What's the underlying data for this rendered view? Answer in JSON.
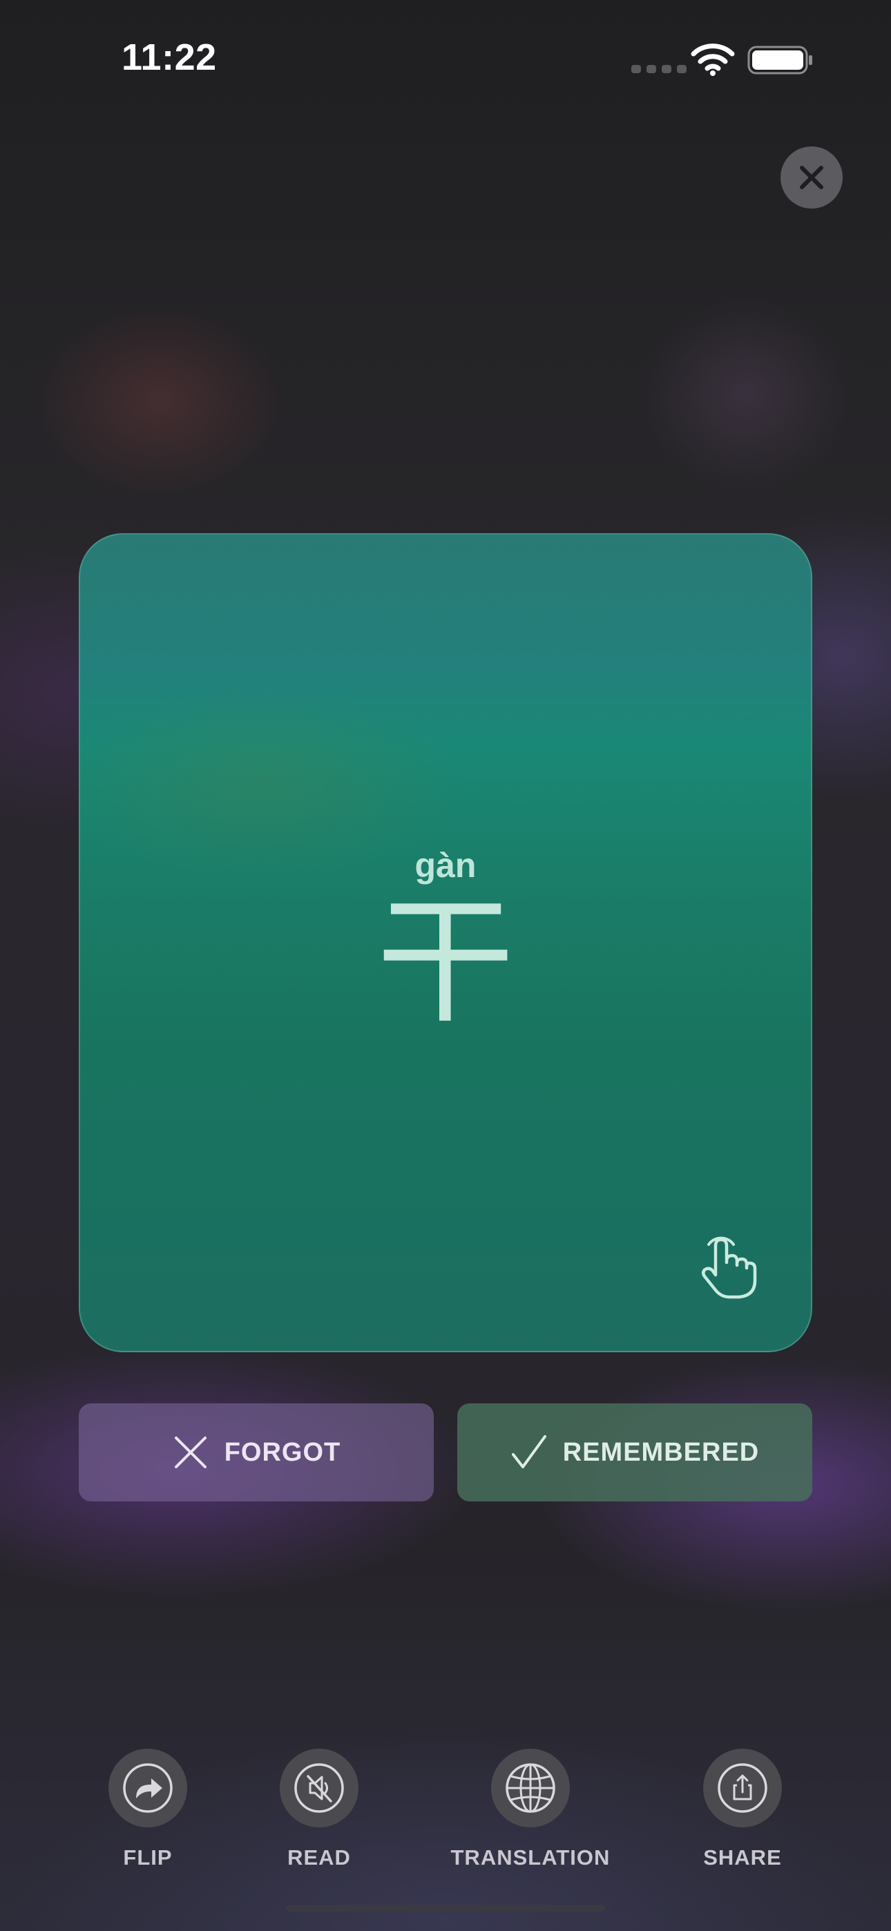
{
  "status_bar": {
    "time": "11:22"
  },
  "card": {
    "pinyin": "gàn",
    "character": "干",
    "hint_icon": "tap-hand-icon"
  },
  "actions": {
    "forgot_label": "FORGOT",
    "remembered_label": "REMEMBERED"
  },
  "toolbar": {
    "items": [
      {
        "label": "FLIP",
        "icon": "flip-arrow-icon"
      },
      {
        "label": "READ",
        "icon": "speaker-muted-icon"
      },
      {
        "label": "TRANSLATION",
        "icon": "globe-icon"
      },
      {
        "label": "SHARE",
        "icon": "share-icon"
      }
    ]
  },
  "colors": {
    "card_top": "#2a7a75",
    "card_bottom": "#1d6e60",
    "forgot_bg": "#6e5f86",
    "remembered_bg": "#466e5a",
    "toolbar_circle": "#4b4a4f"
  }
}
